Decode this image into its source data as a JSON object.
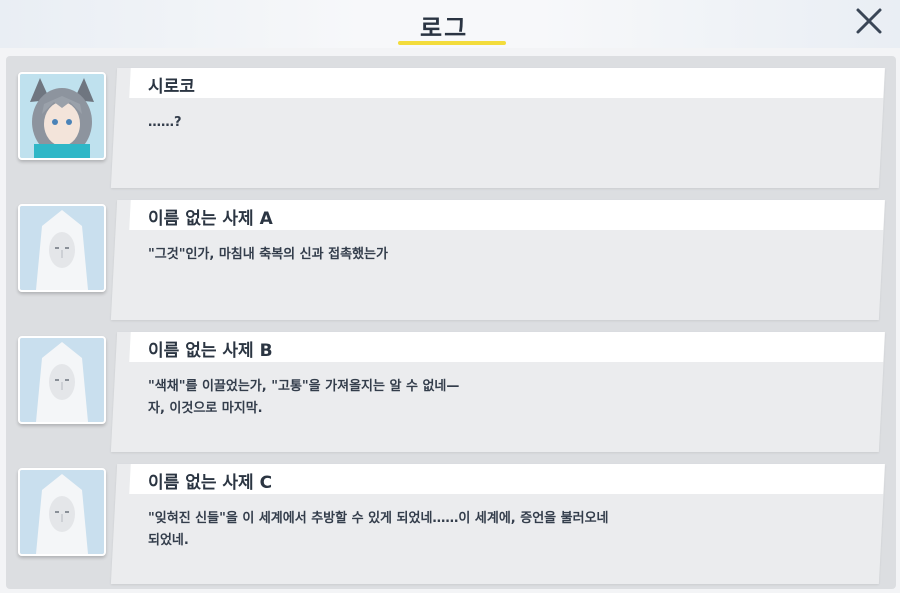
{
  "header": {
    "title": "로그",
    "close_icon": "close-icon"
  },
  "colors": {
    "accent": "#f3dc3c",
    "panel": "#dcdee1",
    "bubble": "#ebecee"
  },
  "entries": [
    {
      "speaker": "시로코",
      "text": "……?",
      "avatar": "shiroko-avatar"
    },
    {
      "speaker": "이름 없는 사제 A",
      "text": "\"그것\"인가, 마침내 축복의 신과 접촉했는가",
      "avatar": "priest-avatar"
    },
    {
      "speaker": "이름 없는 사제 B",
      "text": "\"색채\"를 이끌었는가, \"고통\"을 가져올지는 알 수 없네—\n자, 이것으로 마지막.",
      "avatar": "priest-avatar"
    },
    {
      "speaker": "이름 없는 사제 C",
      "text": "\"잊혀진 신들\"을 이 세계에서 추방할 수 있게 되었네……이 세계에, 증언을 불러오네\n되었네.",
      "avatar": "priest-avatar"
    }
  ]
}
